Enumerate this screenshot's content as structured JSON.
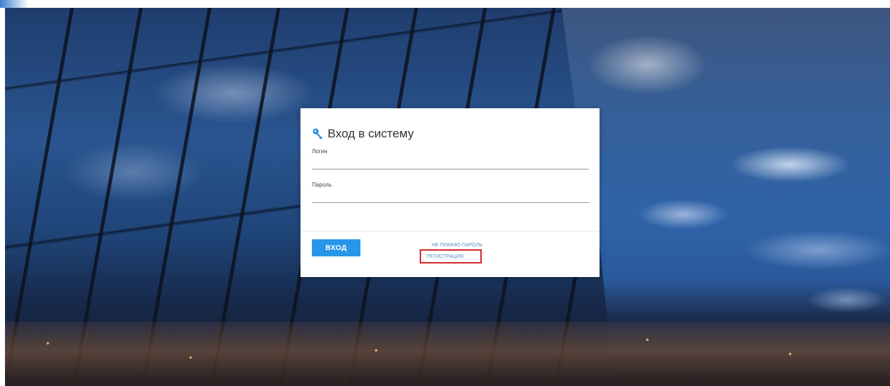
{
  "login": {
    "title": "Вход в систему",
    "title_icon": "key-icon",
    "login_label": "Логин",
    "login_value": "",
    "password_label": "Пароль",
    "password_value": "",
    "submit_label": "ВХОД",
    "forgot_password_label": "НЕ ПОМНЮ ПАРОЛЬ",
    "register_label": "РЕГИСТРАЦИЯ"
  },
  "colors": {
    "accent": "#2696e9",
    "link": "#5c8fc7",
    "highlight_border": "#d22b2b"
  }
}
